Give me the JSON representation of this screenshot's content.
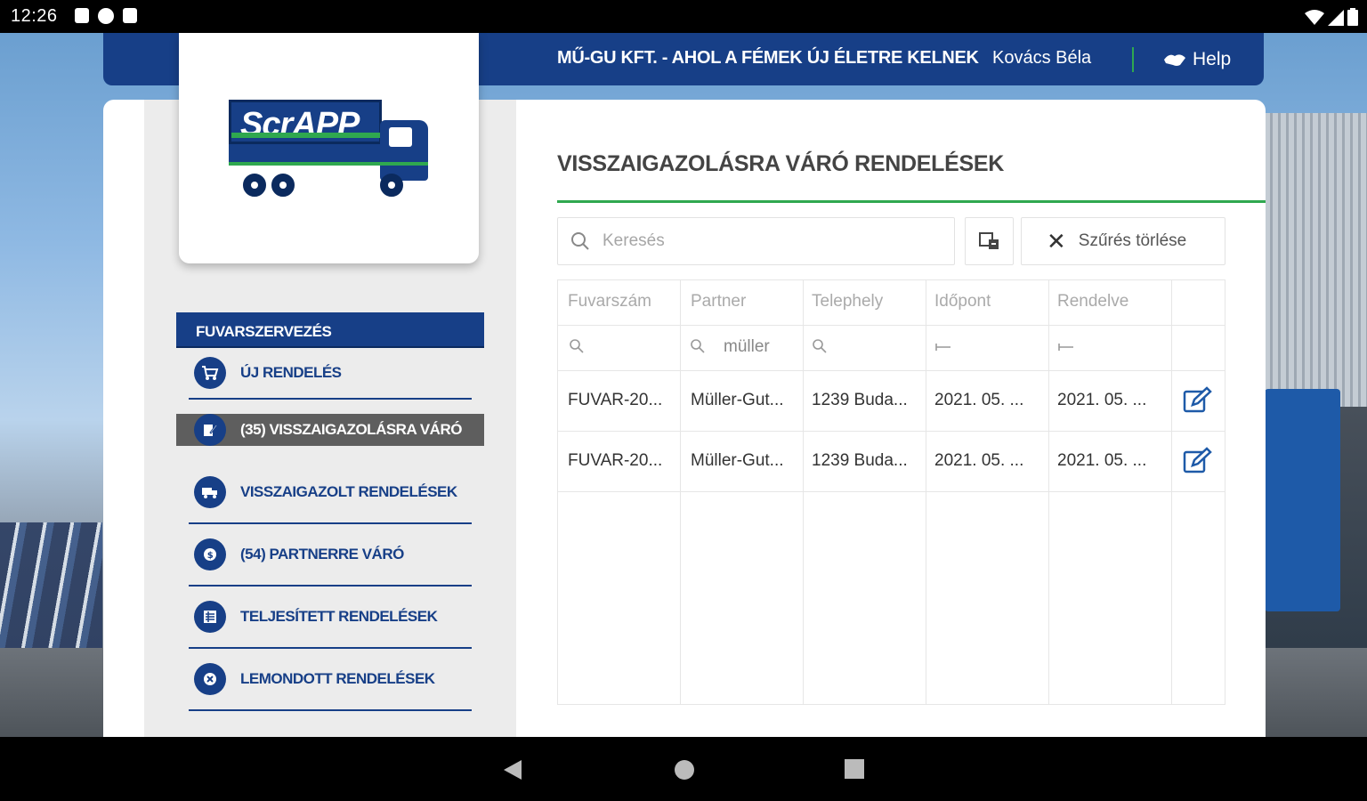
{
  "status_bar": {
    "time": "12:26"
  },
  "header": {
    "company": "MŰ-GU KFT. - AHOL A FÉMEK ÚJ ÉLETRE KELNEK",
    "user": "Kovács Béla",
    "help_label": "Help"
  },
  "logo": {
    "text": "ScrAPP"
  },
  "sidebar": {
    "section_title": "FUVARSZERVEZÉS",
    "items": [
      {
        "label": "ÚJ RENDELÉS",
        "icon": "cart-icon"
      },
      {
        "label": "(35) VISSZAIGAZOLÁSRA VÁRÓ",
        "icon": "edit-document-icon",
        "active": true
      },
      {
        "label": "VISSZAIGAZOLT RENDELÉSEK",
        "icon": "truck-icon"
      },
      {
        "label": "(54) PARTNERRE VÁRÓ",
        "icon": "coin-icon"
      },
      {
        "label": "TELJESÍTETT RENDELÉSEK",
        "icon": "list-icon"
      },
      {
        "label": "LEMONDOTT RENDELÉSEK",
        "icon": "cancel-icon"
      }
    ]
  },
  "main": {
    "title": "VISSZAIGAZOLÁSRA VÁRÓ RENDELÉSEK",
    "search_placeholder": "Keresés",
    "clear_filter_label": "Szűrés törlése",
    "columns": [
      "Fuvarszám",
      "Partner",
      "Telephely",
      "Időpont",
      "Rendelve"
    ],
    "filters": {
      "partner": "müller"
    },
    "rows": [
      {
        "fuvarszam": "FUVAR-20...",
        "partner": "Müller-Gut...",
        "telephely": "1239 Buda...",
        "idopont": "2021. 05. ...",
        "rendelve": "2021. 05. ..."
      },
      {
        "fuvarszam": "FUVAR-20...",
        "partner": "Müller-Gut...",
        "telephely": "1239 Buda...",
        "idopont": "2021. 05. ...",
        "rendelve": "2021. 05. ..."
      }
    ]
  },
  "colors": {
    "primary": "#173f87",
    "accent": "#2fa84f",
    "active_item": "#5e5e5e"
  }
}
